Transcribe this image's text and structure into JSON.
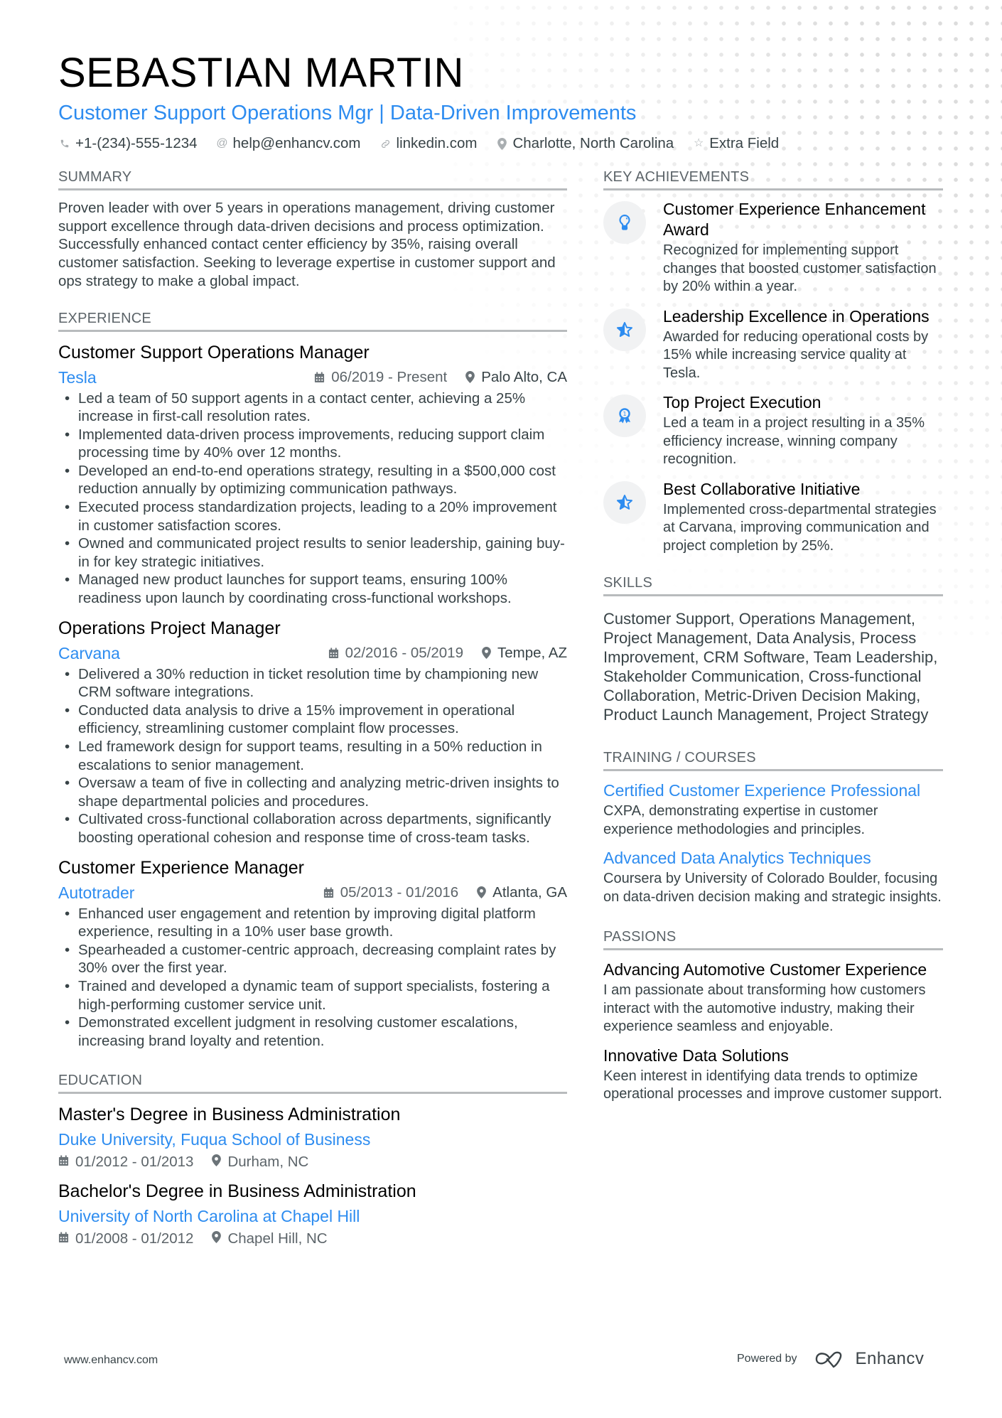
{
  "header": {
    "name": "SEBASTIAN MARTIN",
    "headline": "Customer Support Operations Mgr | Data-Driven Improvements",
    "contacts": [
      {
        "icon": "phone-icon",
        "text": "+1-(234)-555-1234"
      },
      {
        "icon": "at-icon",
        "text": "help@enhancv.com"
      },
      {
        "icon": "link-icon",
        "text": "linkedin.com"
      },
      {
        "icon": "location-pin-icon",
        "text": "Charlotte, North Carolina"
      },
      {
        "icon": "star-outline-icon",
        "text": "Extra Field"
      }
    ]
  },
  "summary": {
    "title": "SUMMARY",
    "text": "Proven leader with over 5 years in operations management, driving customer support excellence through data-driven decisions and process optimization. Successfully enhanced contact center efficiency by 35%, raising overall customer satisfaction. Seeking to leverage expertise in customer support and ops strategy to make a global impact."
  },
  "experience": {
    "title": "EXPERIENCE",
    "jobs": [
      {
        "title": "Customer Support Operations Manager",
        "company": "Tesla",
        "dates": "06/2019 - Present",
        "location": "Palo Alto, CA",
        "bullets": [
          "Led a team of 50 support agents in a contact center, achieving a 25% increase in first-call resolution rates.",
          "Implemented data-driven process improvements, reducing support claim processing time by 40% over 12 months.",
          "Developed an end-to-end operations strategy, resulting in a $500,000 cost reduction annually by optimizing communication pathways.",
          "Executed process standardization projects, leading to a 20% improvement in customer satisfaction scores.",
          "Owned and communicated project results to senior leadership, gaining buy-in for key strategic initiatives.",
          "Managed new product launches for support teams, ensuring 100% readiness upon launch by coordinating cross-functional workshops."
        ]
      },
      {
        "title": "Operations Project Manager",
        "company": "Carvana",
        "dates": "02/2016 - 05/2019",
        "location": "Tempe, AZ",
        "bullets": [
          "Delivered a 30% reduction in ticket resolution time by championing new CRM software integrations.",
          "Conducted data analysis to drive a 15% improvement in operational efficiency, streamlining customer complaint flow processes.",
          "Led framework design for support teams, resulting in a 50% reduction in escalations to senior management.",
          "Oversaw a team of five in collecting and analyzing metric-driven insights to shape departmental policies and procedures.",
          "Cultivated cross-functional collaboration across departments, significantly boosting operational cohesion and response time of cross-team tasks."
        ]
      },
      {
        "title": "Customer Experience Manager",
        "company": "Autotrader",
        "dates": "05/2013 - 01/2016",
        "location": "Atlanta, GA",
        "bullets": [
          "Enhanced user engagement and retention by improving digital platform experience, resulting in a 10% user base growth.",
          "Spearheaded a customer-centric approach, decreasing complaint rates by 30% over the first year.",
          "Trained and developed a dynamic team of support specialists, fostering a high-performing customer service unit.",
          "Demonstrated excellent judgment in resolving customer escalations, increasing brand loyalty and retention."
        ]
      }
    ]
  },
  "education": {
    "title": "EDUCATION",
    "items": [
      {
        "degree": "Master's Degree in Business Administration",
        "school": "Duke University, Fuqua School of Business",
        "dates": "01/2012 - 01/2013",
        "location": "Durham, NC"
      },
      {
        "degree": "Bachelor's Degree in Business Administration",
        "school": "University of North Carolina at Chapel Hill",
        "dates": "01/2008 - 01/2012",
        "location": "Chapel Hill, NC"
      }
    ]
  },
  "achievements": {
    "title": "KEY ACHIEVEMENTS",
    "items": [
      {
        "icon": "lightbulb-icon",
        "title": "Customer Experience Enhancement Award",
        "desc": "Recognized for implementing support changes that boosted customer satisfaction by 20% within a year."
      },
      {
        "icon": "half-star-icon",
        "title": "Leadership Excellence in Operations",
        "desc": "Awarded for reducing operational costs by 15% while increasing service quality at Tesla."
      },
      {
        "icon": "award-ribbon-icon",
        "title": "Top Project Execution",
        "desc": "Led a team in a project resulting in a 35% efficiency increase, winning company recognition."
      },
      {
        "icon": "half-star-icon",
        "title": "Best Collaborative Initiative",
        "desc": "Implemented cross-departmental strategies at Carvana, improving communication and project completion by 25%."
      }
    ]
  },
  "skills": {
    "title": "SKILLS",
    "text": "Customer Support, Operations Management, Project Management, Data Analysis, Process Improvement, CRM Software, Team Leadership, Stakeholder Communication, Cross-functional Collaboration, Metric-Driven Decision Making, Product Launch Management, Project Strategy"
  },
  "training": {
    "title": "TRAINING / COURSES",
    "items": [
      {
        "title": "Certified Customer Experience Professional",
        "desc": "CXPA, demonstrating expertise in customer experience methodologies and principles."
      },
      {
        "title": "Advanced Data Analytics Techniques",
        "desc": "Coursera by University of Colorado Boulder, focusing on data-driven decision making and strategic insights."
      }
    ]
  },
  "passions": {
    "title": "PASSIONS",
    "items": [
      {
        "title": "Advancing Automotive Customer Experience",
        "desc": "I am passionate about transforming how customers interact with the automotive industry, making their experience seamless and enjoyable."
      },
      {
        "title": "Innovative Data Solutions",
        "desc": "Keen interest in identifying data trends to optimize operational processes and improve customer support."
      }
    ]
  },
  "footer": {
    "website": "www.enhancv.com",
    "powered_by": "Powered by",
    "brand": "Enhancv"
  },
  "colors": {
    "accent": "#2d8cf0",
    "text": "#384347",
    "heading": "#000000",
    "rule": "#b8bbbd"
  }
}
